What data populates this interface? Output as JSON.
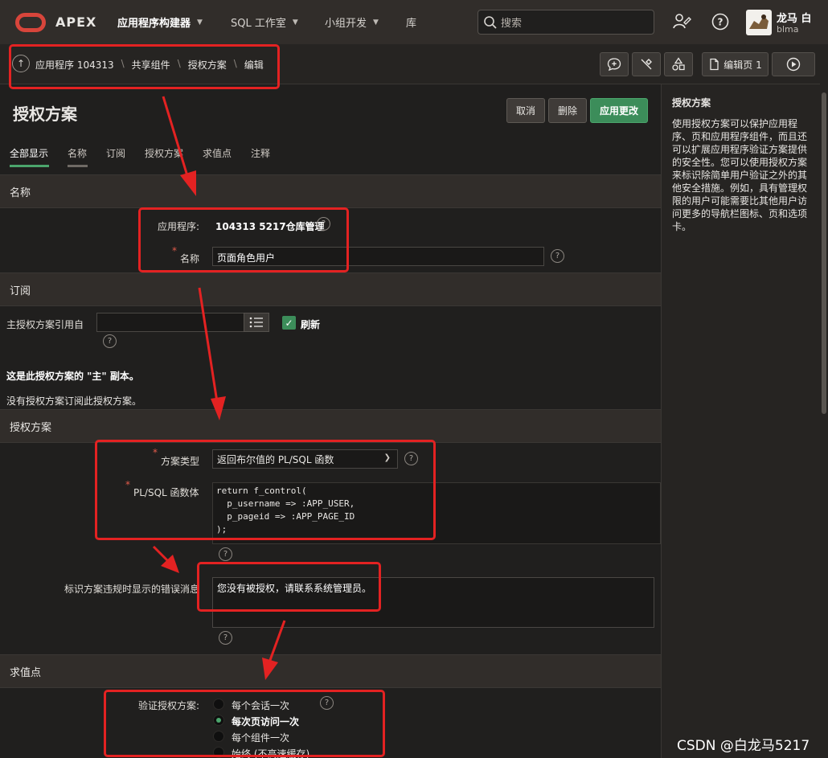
{
  "topnav": {
    "logo_text": "APEX",
    "items": [
      {
        "label": "应用程序构建器",
        "active": true
      },
      {
        "label": "SQL 工作室",
        "active": false
      },
      {
        "label": "小组开发",
        "active": false
      },
      {
        "label": "库",
        "active": false
      }
    ],
    "search_placeholder": "搜索",
    "user_name": "龙马 白",
    "user_id": "blma"
  },
  "breadcrumb": {
    "items": [
      "应用程序 104313",
      "共享组件",
      "授权方案",
      "编辑"
    ]
  },
  "toolbar": {
    "edit_page_label": "编辑页 1"
  },
  "page": {
    "title": "授权方案",
    "cancel_label": "取消",
    "delete_label": "删除",
    "apply_label": "应用更改"
  },
  "tabs": [
    "全部显示",
    "名称",
    "订阅",
    "授权方案",
    "求值点",
    "注释"
  ],
  "help_panel": {
    "title": "授权方案",
    "body": "使用授权方案可以保护应用程序、页和应用程序组件，而且还可以扩展应用程序验证方案提供的安全性。您可以使用授权方案来标识除简单用户验证之外的其他安全措施。例如，具有管理权限的用户可能需要比其他用户访问更多的导航栏图标、页和选项卡。"
  },
  "regions": {
    "name": {
      "title": "名称",
      "app_label": "应用程序:",
      "app_value": "104313 5217仓库管理",
      "name_label": "名称",
      "name_value": "页面角色用户"
    },
    "subscription": {
      "title": "订阅",
      "master_label": "主授权方案引用自",
      "master_value": "",
      "refresh_label": "刷新",
      "master_copy_text": "这是此授权方案的 \"主\" 副本。",
      "no_subscription_text": "没有授权方案订阅此授权方案。"
    },
    "scheme": {
      "title": "授权方案",
      "type_label": "方案类型",
      "type_value": "返回布尔值的 PL/SQL 函数",
      "body_label": "PL/SQL 函数体",
      "body_lines": [
        "return f_control(",
        "  p_username => :APP_USER,",
        "  p_pageid => :APP_PAGE_ID",
        ");"
      ],
      "error_label": "标识方案违规时显示的错误消息",
      "error_value": "您没有被授权，请联系系统管理员。"
    },
    "evaluation": {
      "title": "求值点",
      "validate_label": "验证授权方案:",
      "options": [
        {
          "label": "每个会话一次",
          "selected": false
        },
        {
          "label": "每次页访问一次",
          "selected": true
        },
        {
          "label": "每个组件一次",
          "selected": false
        },
        {
          "label": "始终 (不高速缓存)",
          "selected": false
        }
      ]
    }
  },
  "watermark": "CSDN @白龙马5217",
  "colors": {
    "accent_green": "#3c8d5a",
    "annotation_red": "#e32222",
    "logo_red": "#d8453b"
  }
}
